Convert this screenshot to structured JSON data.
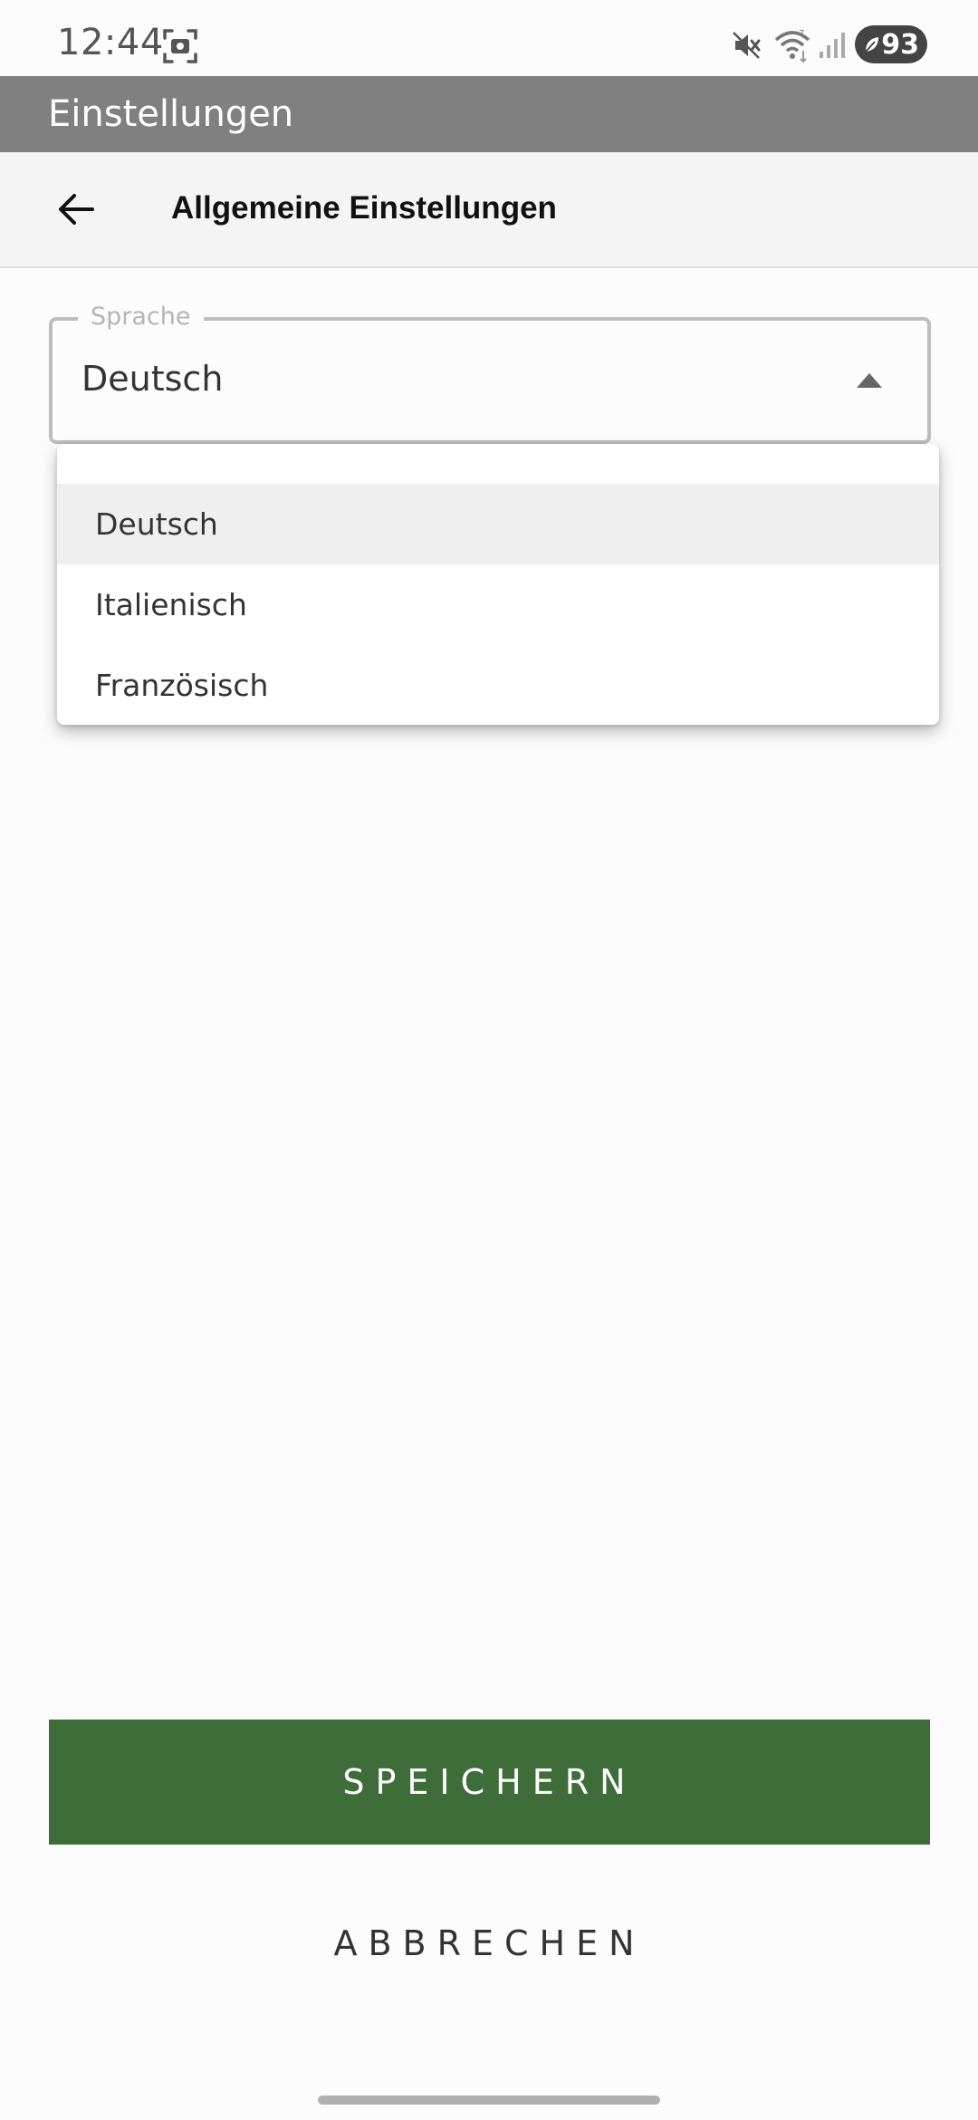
{
  "status_bar": {
    "time": "12:44",
    "battery": "93",
    "icons": [
      "screenshot-icon",
      "mute-icon",
      "wifi-icon",
      "signal-icon",
      "battery-saver-leaf-icon"
    ]
  },
  "app_bar": {
    "title": "Einstellungen"
  },
  "sub_header": {
    "title": "Allgemeine Einstellungen",
    "back_icon": "arrow-left-icon"
  },
  "language_select": {
    "label": "Sprache",
    "value": "Deutsch",
    "arrow_icon": "caret-up-icon",
    "options": [
      {
        "label": "Deutsch",
        "selected": true
      },
      {
        "label": "Italienisch",
        "selected": false
      },
      {
        "label": "Französisch",
        "selected": false
      }
    ]
  },
  "actions": {
    "save_label": "SPEICHERN",
    "cancel_label": "ABBRECHEN"
  },
  "colors": {
    "app_bar": "#808080",
    "save_button": "#3e6d39",
    "selected_option": "#efefef"
  }
}
